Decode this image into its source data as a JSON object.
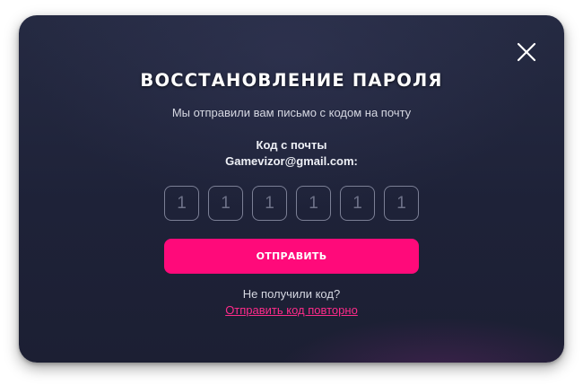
{
  "modal": {
    "title": "ВОССТАНОВЛЕНИЕ ПАРОЛЯ",
    "subtitle": "Мы отправили вам письмо с кодом на почту",
    "code_label_line1": "Код с почты",
    "code_label_line2": "Gamevizor@gmail.com:",
    "close_icon": "close-icon",
    "code_inputs": [
      {
        "placeholder": "1",
        "value": ""
      },
      {
        "placeholder": "1",
        "value": ""
      },
      {
        "placeholder": "1",
        "value": ""
      },
      {
        "placeholder": "1",
        "value": ""
      },
      {
        "placeholder": "1",
        "value": ""
      },
      {
        "placeholder": "1",
        "value": ""
      }
    ],
    "submit_label": "ОТПРАВИТЬ",
    "no_code_text": "Не получили код?",
    "resend_link": "Отправить код повторно"
  },
  "colors": {
    "accent": "#ff0a7a",
    "link": "#ff2b8a",
    "modal_background": "#1e2238",
    "input_border": "#7b7f95"
  }
}
